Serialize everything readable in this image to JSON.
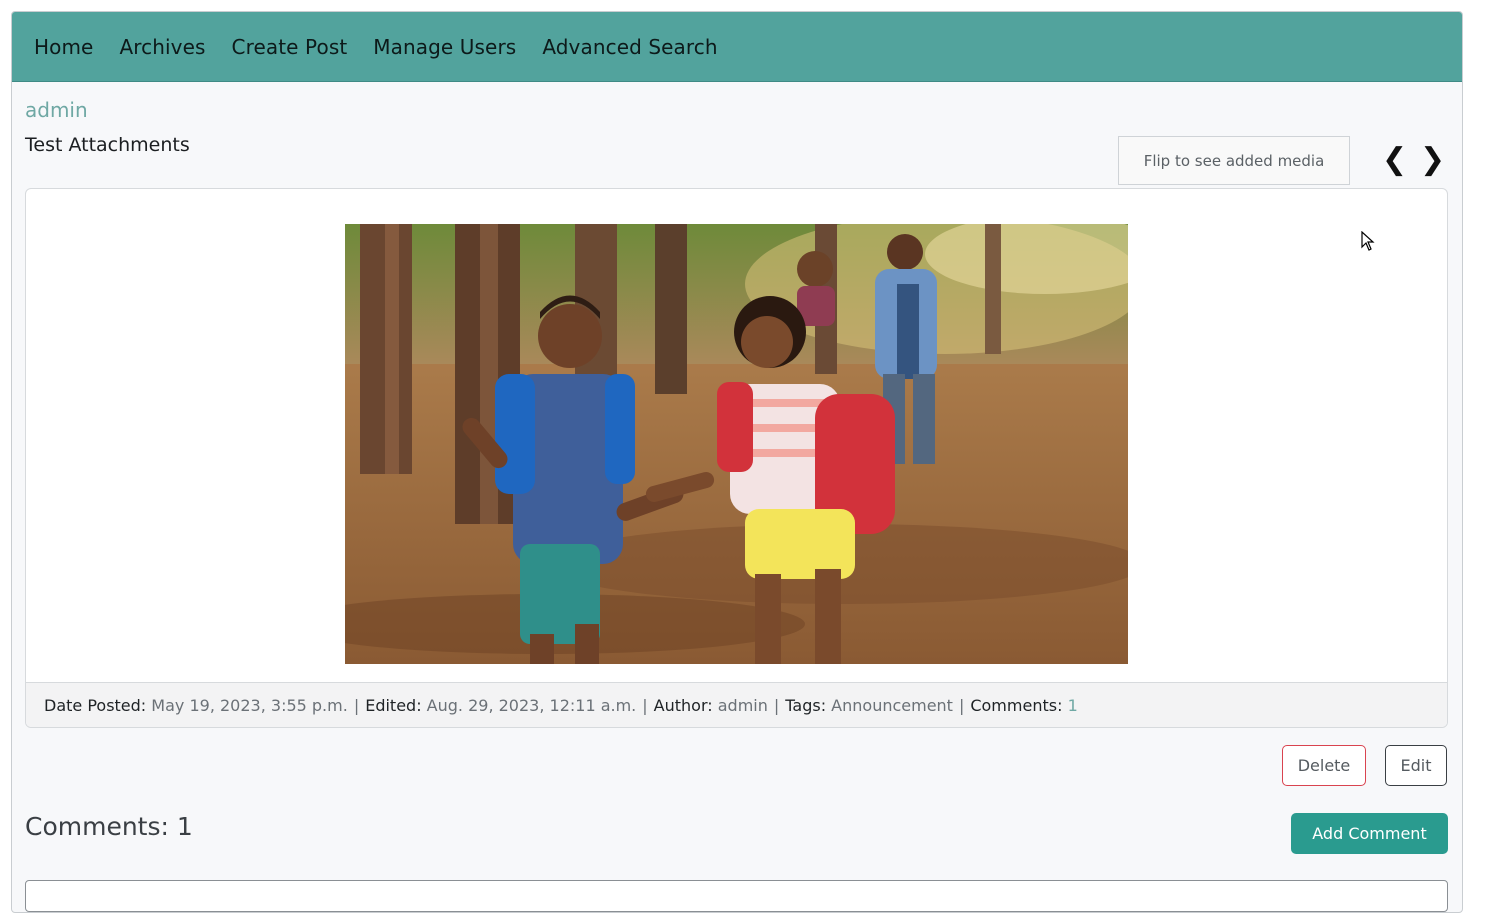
{
  "nav": {
    "items": [
      "Home",
      "Archives",
      "Create Post",
      "Manage Users",
      "Advanced Search"
    ]
  },
  "post": {
    "author": "admin",
    "title": "Test Attachments",
    "flip_label": "Flip to see added media",
    "prev_arrow": "❮",
    "next_arrow": "❯",
    "meta": {
      "date_label": "Date Posted:",
      "date_value": "May 19, 2023, 3:55 p.m.",
      "edited_label": "Edited:",
      "edited_value": "Aug. 29, 2023, 12:11 a.m.",
      "author_label": "Author:",
      "author_value": "admin",
      "tags_label": "Tags:",
      "tags_value": "Announcement",
      "comments_label": "Comments:",
      "comments_value": "1",
      "separator": "|"
    }
  },
  "actions": {
    "delete": "Delete",
    "edit": "Edit",
    "add_comment": "Add Comment"
  },
  "comments": {
    "heading": "Comments: 1"
  },
  "colors": {
    "navbar": "#52a39d",
    "accent": "#2a9b8f",
    "danger": "#d9434f"
  }
}
